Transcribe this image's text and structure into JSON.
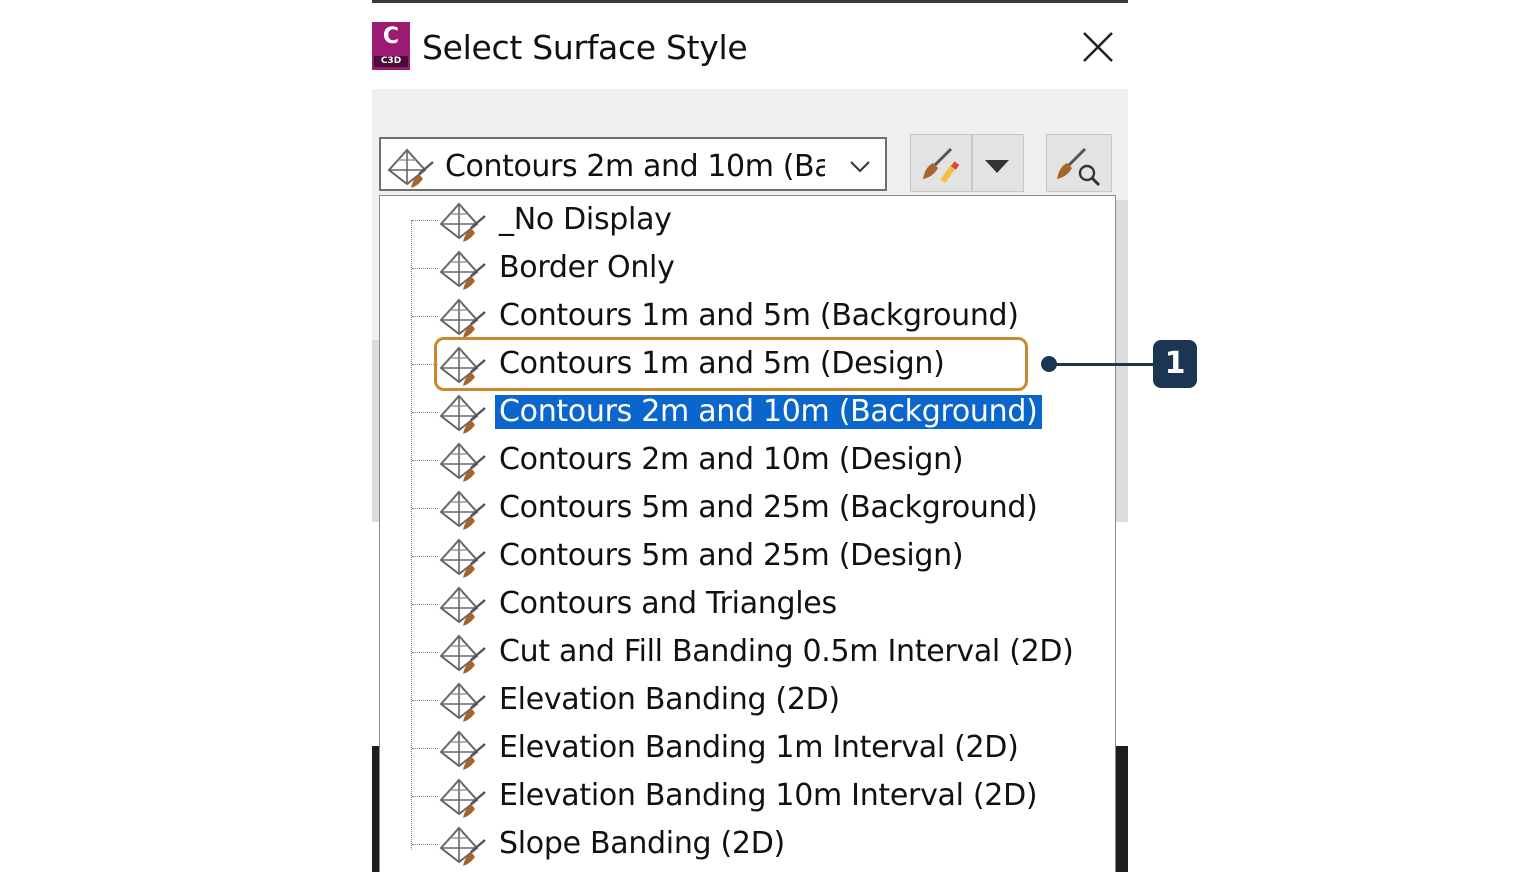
{
  "dialog": {
    "title": "Select Surface Style",
    "app_badge": "C",
    "app_badge_sub": "C3D"
  },
  "combo": {
    "selected_value": "Contours 2m and 10m (Background)"
  },
  "list": {
    "items": [
      {
        "label": "_No Display"
      },
      {
        "label": "Border Only"
      },
      {
        "label": "Contours 1m and 5m (Background)"
      },
      {
        "label": "Contours 1m and 5m (Design)"
      },
      {
        "label": "Contours 2m and 10m (Background)"
      },
      {
        "label": "Contours 2m and 10m (Design)"
      },
      {
        "label": "Contours 5m and 25m (Background)"
      },
      {
        "label": "Contours 5m and 25m (Design)"
      },
      {
        "label": "Contours and Triangles"
      },
      {
        "label": "Cut and Fill Banding 0.5m Interval (2D)"
      },
      {
        "label": "Elevation Banding (2D)"
      },
      {
        "label": "Elevation Banding 1m Interval (2D)"
      },
      {
        "label": "Elevation Banding 10m Interval (2D)"
      },
      {
        "label": "Slope Banding (2D)"
      }
    ],
    "selected_index": 4,
    "highlighted_index": 3
  },
  "callout": {
    "number": "1"
  },
  "colors": {
    "selection": "#0a66cc",
    "highlight_outline": "#c98a2e",
    "callout": "#1c3553",
    "app_icon": "#9b1b72"
  },
  "icons": {
    "style_icon": "surface-style-icon",
    "edit_icon": "edit-style-icon",
    "browse_icon": "browse-style-icon",
    "close_icon": "close-icon",
    "chevron_icon": "chevron-down-icon"
  }
}
